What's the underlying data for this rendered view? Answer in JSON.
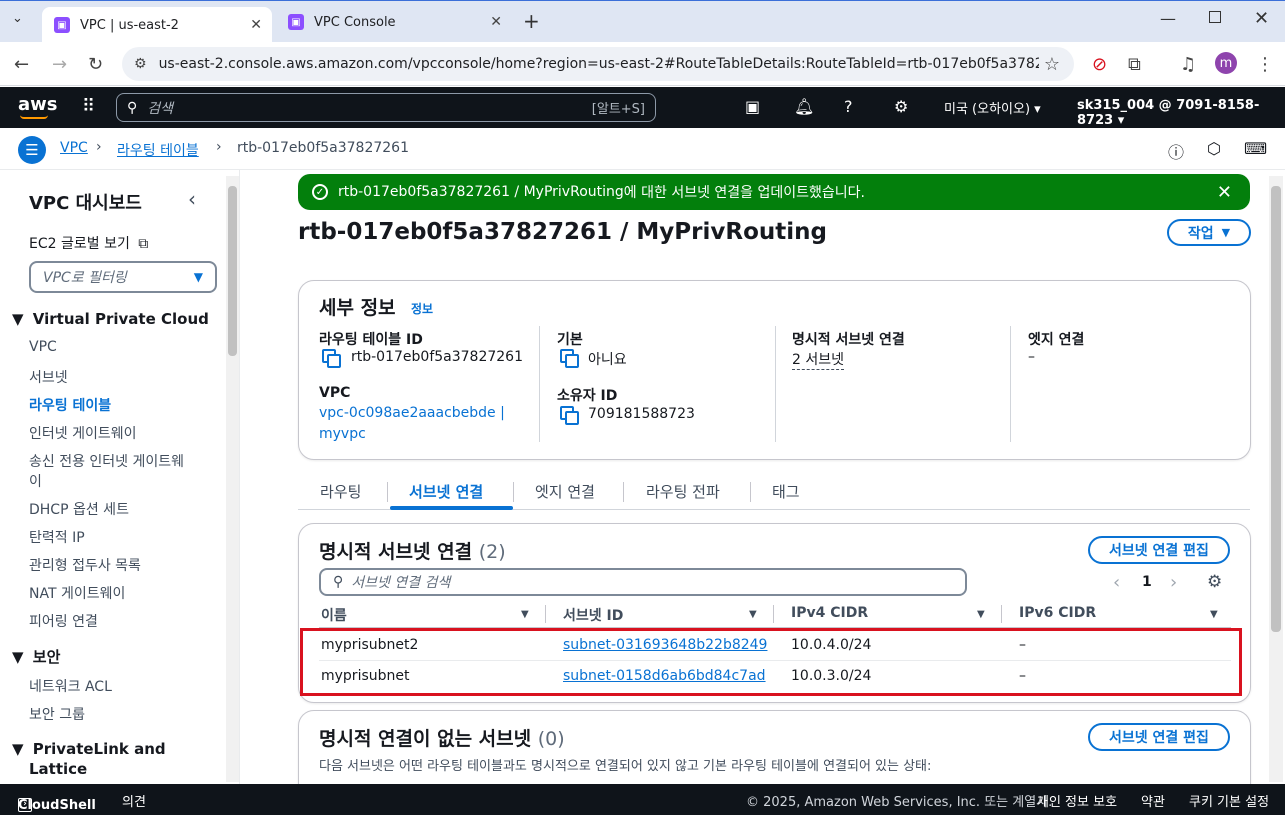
{
  "browser": {
    "tabs": [
      {
        "title": "VPC | us-east-2",
        "active": true
      },
      {
        "title": "VPC Console",
        "active": false
      }
    ],
    "url": "us-east-2.console.aws.amazon.com/vpcconsole/home?region=us-east-2#RouteTableDetails:RouteTableId=rtb-017eb0f5a37827261",
    "profile_initial": "m"
  },
  "aws_header": {
    "logo": "aws",
    "search_placeholder": "검색",
    "search_shortcut": "[알트+S]",
    "region": "미국 (오하이오)",
    "account": "sk315_004 @ 7091-8158-8723"
  },
  "breadcrumb": {
    "items": [
      "VPC",
      "라우팅 테이블"
    ],
    "current": "rtb-017eb0f5a37827261"
  },
  "sidebar": {
    "title": "VPC 대시보드",
    "ec2_global": "EC2 글로벌 보기",
    "filter_placeholder": "VPC로 필터링",
    "section_vpc": "Virtual Private Cloud",
    "items_vpc": [
      "VPC",
      "서브넷",
      "라우팅 테이블",
      "인터넷 게이트웨이",
      "송신 전용 인터넷 게이트웨",
      "이",
      "DHCP 옵션 세트",
      "탄력적 IP",
      "관리형 접두사 목록",
      "NAT 게이트웨이",
      "피어링 연결"
    ],
    "section_security": "보안",
    "items_security": [
      "네트워크 ACL",
      "보안 그룹"
    ],
    "section_privatelink": "PrivateLink and",
    "section_privatelink2": "Lattice"
  },
  "flash": {
    "rtb": "rtb-017eb0f5a37827261 / MyPrivRouting",
    "message": "에 대한 서브넷 연결을 업데이트했습니다."
  },
  "page": {
    "title": "rtb-017eb0f5a37827261 / MyPrivRouting",
    "actions_button": "작업"
  },
  "details": {
    "heading": "세부 정보",
    "info_link": "정보",
    "route_table_id_label": "라우팅 테이블 ID",
    "route_table_id": "rtb-017eb0f5a37827261",
    "main_label": "기본",
    "main_value": "아니요",
    "explicit_label": "명시적 서브넷 연결",
    "explicit_value": "2 서브넷",
    "edge_label": "엣지 연결",
    "edge_value": "–",
    "vpc_label": "VPC",
    "vpc_value_1": "vpc-0c098ae2aaacbebde |",
    "vpc_value_2": "myvpc",
    "owner_label": "소유자 ID",
    "owner_value": "709181588723"
  },
  "tabs": [
    "라우팅",
    "서브넷 연결",
    "엣지 연결",
    "라우팅 전파",
    "태그"
  ],
  "explicit_assoc": {
    "heading": "명시적 서브넷 연결",
    "count": "(2)",
    "edit_button": "서브넷 연결 편집",
    "search_placeholder": "서브넷 연결 검색",
    "page_number": "1",
    "columns": [
      "이름",
      "서브넷 ID",
      "IPv4 CIDR",
      "IPv6 CIDR"
    ],
    "rows": [
      {
        "name": "myprisubnet2",
        "subnet_id": "subnet-031693648b22b8249",
        "ipv4": "10.0.4.0/24",
        "ipv6": "–"
      },
      {
        "name": "myprisubnet",
        "subnet_id": "subnet-0158d6ab6bd84c7ad",
        "ipv4": "10.0.3.0/24",
        "ipv6": "–"
      }
    ]
  },
  "no_assoc": {
    "heading": "명시적 연결이 없는 서브넷",
    "count": "(0)",
    "edit_button": "서브넷 연결 편집",
    "description": "다음 서브넷은 어떤 라우팅 테이블과도 명시적으로 연결되어 있지 않고 기본 라우팅 테이블에 연결되어 있는 상태:"
  },
  "footer": {
    "cloudshell": "CloudShell",
    "feedback": "의견",
    "copyright": "© 2025, Amazon Web Services, Inc. 또는 계열사.",
    "privacy": "개인 정보 보호",
    "terms": "약관",
    "cookies": "쿠키 기본 설정"
  },
  "colors": {
    "aws_dark": "#0f141a",
    "link_blue": "#0972d3",
    "success_green": "#037f0c",
    "highlight_red": "#d9121f"
  }
}
